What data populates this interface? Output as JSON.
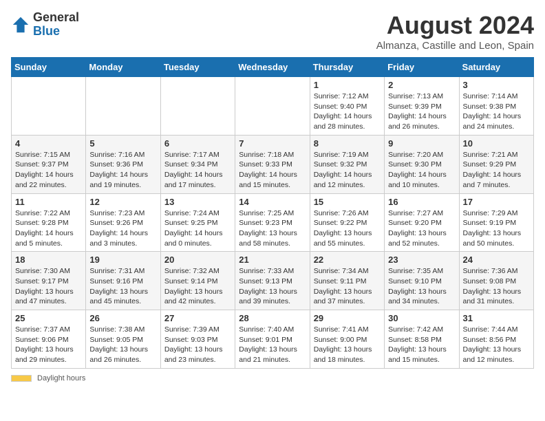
{
  "header": {
    "logo_general": "General",
    "logo_blue": "Blue",
    "title": "August 2024",
    "subtitle": "Almanza, Castille and Leon, Spain"
  },
  "weekdays": [
    "Sunday",
    "Monday",
    "Tuesday",
    "Wednesday",
    "Thursday",
    "Friday",
    "Saturday"
  ],
  "weeks": [
    [
      {
        "day": "",
        "sunrise": "",
        "sunset": "",
        "daylight": ""
      },
      {
        "day": "",
        "sunrise": "",
        "sunset": "",
        "daylight": ""
      },
      {
        "day": "",
        "sunrise": "",
        "sunset": "",
        "daylight": ""
      },
      {
        "day": "",
        "sunrise": "",
        "sunset": "",
        "daylight": ""
      },
      {
        "day": "1",
        "sunrise": "Sunrise: 7:12 AM",
        "sunset": "Sunset: 9:40 PM",
        "daylight": "Daylight: 14 hours and 28 minutes."
      },
      {
        "day": "2",
        "sunrise": "Sunrise: 7:13 AM",
        "sunset": "Sunset: 9:39 PM",
        "daylight": "Daylight: 14 hours and 26 minutes."
      },
      {
        "day": "3",
        "sunrise": "Sunrise: 7:14 AM",
        "sunset": "Sunset: 9:38 PM",
        "daylight": "Daylight: 14 hours and 24 minutes."
      }
    ],
    [
      {
        "day": "4",
        "sunrise": "Sunrise: 7:15 AM",
        "sunset": "Sunset: 9:37 PM",
        "daylight": "Daylight: 14 hours and 22 minutes."
      },
      {
        "day": "5",
        "sunrise": "Sunrise: 7:16 AM",
        "sunset": "Sunset: 9:36 PM",
        "daylight": "Daylight: 14 hours and 19 minutes."
      },
      {
        "day": "6",
        "sunrise": "Sunrise: 7:17 AM",
        "sunset": "Sunset: 9:34 PM",
        "daylight": "Daylight: 14 hours and 17 minutes."
      },
      {
        "day": "7",
        "sunrise": "Sunrise: 7:18 AM",
        "sunset": "Sunset: 9:33 PM",
        "daylight": "Daylight: 14 hours and 15 minutes."
      },
      {
        "day": "8",
        "sunrise": "Sunrise: 7:19 AM",
        "sunset": "Sunset: 9:32 PM",
        "daylight": "Daylight: 14 hours and 12 minutes."
      },
      {
        "day": "9",
        "sunrise": "Sunrise: 7:20 AM",
        "sunset": "Sunset: 9:30 PM",
        "daylight": "Daylight: 14 hours and 10 minutes."
      },
      {
        "day": "10",
        "sunrise": "Sunrise: 7:21 AM",
        "sunset": "Sunset: 9:29 PM",
        "daylight": "Daylight: 14 hours and 7 minutes."
      }
    ],
    [
      {
        "day": "11",
        "sunrise": "Sunrise: 7:22 AM",
        "sunset": "Sunset: 9:28 PM",
        "daylight": "Daylight: 14 hours and 5 minutes."
      },
      {
        "day": "12",
        "sunrise": "Sunrise: 7:23 AM",
        "sunset": "Sunset: 9:26 PM",
        "daylight": "Daylight: 14 hours and 3 minutes."
      },
      {
        "day": "13",
        "sunrise": "Sunrise: 7:24 AM",
        "sunset": "Sunset: 9:25 PM",
        "daylight": "Daylight: 14 hours and 0 minutes."
      },
      {
        "day": "14",
        "sunrise": "Sunrise: 7:25 AM",
        "sunset": "Sunset: 9:23 PM",
        "daylight": "Daylight: 13 hours and 58 minutes."
      },
      {
        "day": "15",
        "sunrise": "Sunrise: 7:26 AM",
        "sunset": "Sunset: 9:22 PM",
        "daylight": "Daylight: 13 hours and 55 minutes."
      },
      {
        "day": "16",
        "sunrise": "Sunrise: 7:27 AM",
        "sunset": "Sunset: 9:20 PM",
        "daylight": "Daylight: 13 hours and 52 minutes."
      },
      {
        "day": "17",
        "sunrise": "Sunrise: 7:29 AM",
        "sunset": "Sunset: 9:19 PM",
        "daylight": "Daylight: 13 hours and 50 minutes."
      }
    ],
    [
      {
        "day": "18",
        "sunrise": "Sunrise: 7:30 AM",
        "sunset": "Sunset: 9:17 PM",
        "daylight": "Daylight: 13 hours and 47 minutes."
      },
      {
        "day": "19",
        "sunrise": "Sunrise: 7:31 AM",
        "sunset": "Sunset: 9:16 PM",
        "daylight": "Daylight: 13 hours and 45 minutes."
      },
      {
        "day": "20",
        "sunrise": "Sunrise: 7:32 AM",
        "sunset": "Sunset: 9:14 PM",
        "daylight": "Daylight: 13 hours and 42 minutes."
      },
      {
        "day": "21",
        "sunrise": "Sunrise: 7:33 AM",
        "sunset": "Sunset: 9:13 PM",
        "daylight": "Daylight: 13 hours and 39 minutes."
      },
      {
        "day": "22",
        "sunrise": "Sunrise: 7:34 AM",
        "sunset": "Sunset: 9:11 PM",
        "daylight": "Daylight: 13 hours and 37 minutes."
      },
      {
        "day": "23",
        "sunrise": "Sunrise: 7:35 AM",
        "sunset": "Sunset: 9:10 PM",
        "daylight": "Daylight: 13 hours and 34 minutes."
      },
      {
        "day": "24",
        "sunrise": "Sunrise: 7:36 AM",
        "sunset": "Sunset: 9:08 PM",
        "daylight": "Daylight: 13 hours and 31 minutes."
      }
    ],
    [
      {
        "day": "25",
        "sunrise": "Sunrise: 7:37 AM",
        "sunset": "Sunset: 9:06 PM",
        "daylight": "Daylight: 13 hours and 29 minutes."
      },
      {
        "day": "26",
        "sunrise": "Sunrise: 7:38 AM",
        "sunset": "Sunset: 9:05 PM",
        "daylight": "Daylight: 13 hours and 26 minutes."
      },
      {
        "day": "27",
        "sunrise": "Sunrise: 7:39 AM",
        "sunset": "Sunset: 9:03 PM",
        "daylight": "Daylight: 13 hours and 23 minutes."
      },
      {
        "day": "28",
        "sunrise": "Sunrise: 7:40 AM",
        "sunset": "Sunset: 9:01 PM",
        "daylight": "Daylight: 13 hours and 21 minutes."
      },
      {
        "day": "29",
        "sunrise": "Sunrise: 7:41 AM",
        "sunset": "Sunset: 9:00 PM",
        "daylight": "Daylight: 13 hours and 18 minutes."
      },
      {
        "day": "30",
        "sunrise": "Sunrise: 7:42 AM",
        "sunset": "Sunset: 8:58 PM",
        "daylight": "Daylight: 13 hours and 15 minutes."
      },
      {
        "day": "31",
        "sunrise": "Sunrise: 7:44 AM",
        "sunset": "Sunset: 8:56 PM",
        "daylight": "Daylight: 13 hours and 12 minutes."
      }
    ]
  ],
  "footer": {
    "daylight_label": "Daylight hours"
  }
}
